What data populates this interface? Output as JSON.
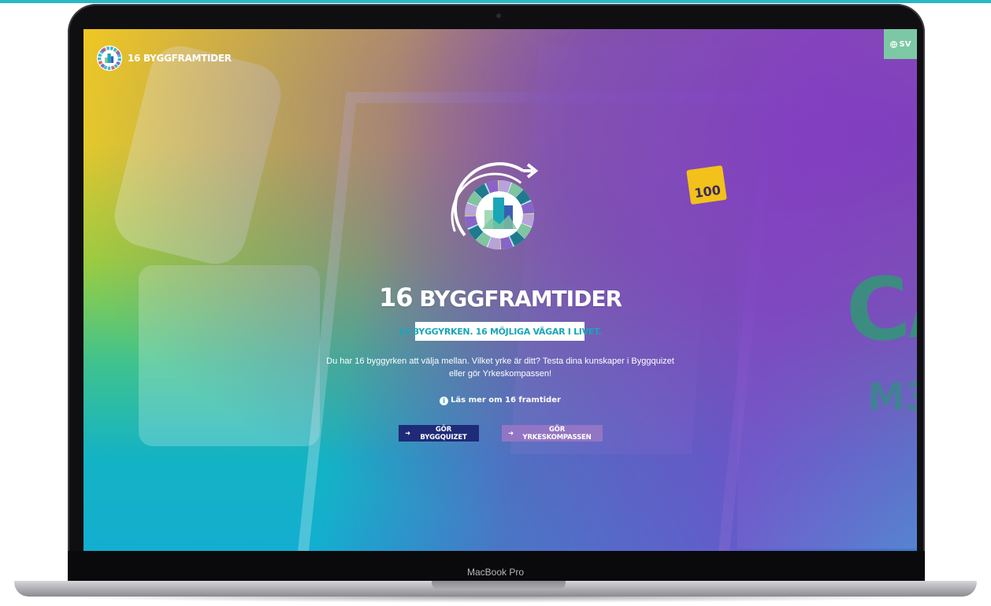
{
  "device": {
    "model_label": "MacBook Pro"
  },
  "site": {
    "brand_name": "16 BYGGFRAMTIDER",
    "language_button": "SV"
  },
  "hero": {
    "title_number": "16",
    "title_text": "BYGGFRAMTIDER",
    "tagline": "16 BYGGYRKEN. 16 MÖJLIGA VÄGAR I LIVET.",
    "description": "Du har 16 byggyrken att välja mellan. Vilket yrke är ditt? Testa dina kunskaper i Byggquizet eller gör Yrkeskompassen!",
    "read_more": "Läs mer om 16 framtider",
    "buttons": {
      "quiz": "GÖR BYGGQUIZET",
      "kompass": "GÖR YRKESKOMPASSEN"
    }
  },
  "background": {
    "sticker_text": "100",
    "machine_brand": "CA",
    "machine_model": "M3"
  },
  "colors": {
    "teal": "#1aa6b7",
    "yellow": "#f6cc1b",
    "purple": "#7c3abe",
    "quiz_button": "#1f2a78",
    "kompass_button": "#9275c4",
    "language_button": "#7dc8a4"
  },
  "icons": {
    "arrow": "arrow-right-icon",
    "info": "info-icon",
    "globe": "globe-icon"
  }
}
